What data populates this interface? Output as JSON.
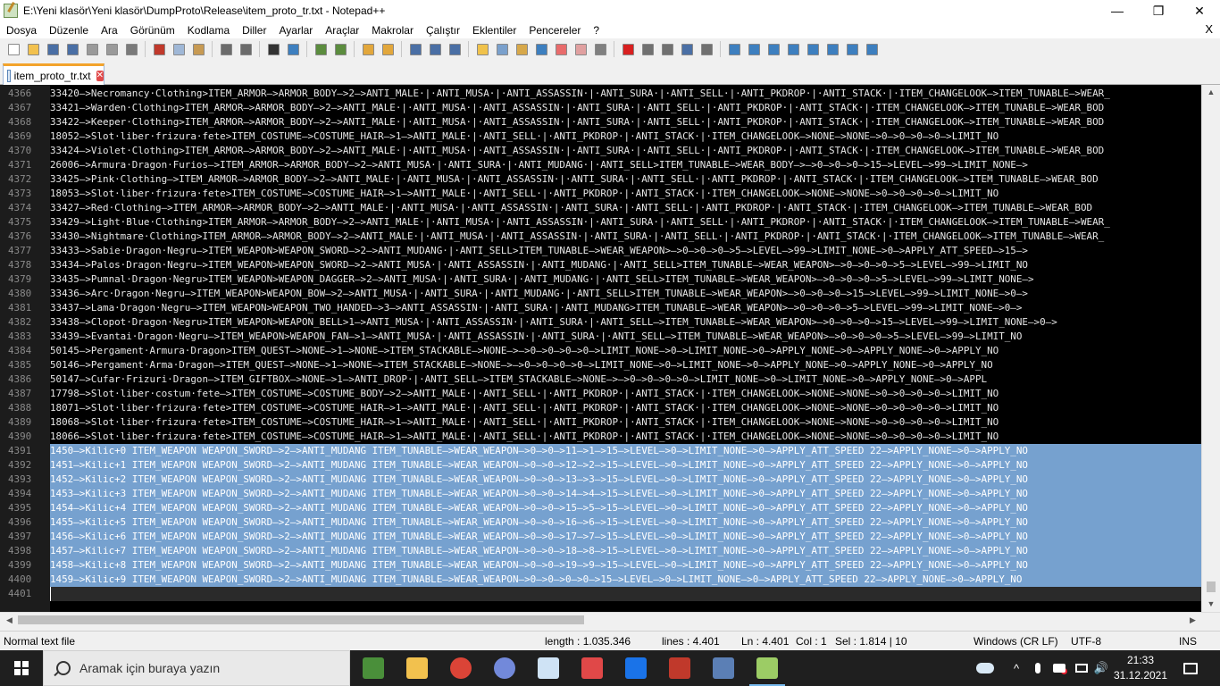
{
  "window": {
    "title": "E:\\Yeni klasör\\Yeni klasör\\DumpProto\\Release\\item_proto_tr.txt - Notepad++",
    "minimize_glyph": "—",
    "maximize_glyph": "❐",
    "close_glyph": "✕"
  },
  "menu": {
    "items": [
      "Dosya",
      "Düzenle",
      "Ara",
      "Görünüm",
      "Kodlama",
      "Diller",
      "Ayarlar",
      "Araçlar",
      "Makrolar",
      "Çalıştır",
      "Eklentiler",
      "Pencereler",
      "?"
    ],
    "close_glyph": "X"
  },
  "toolbar": {
    "buttons": [
      {
        "name": "new-file-icon",
        "color": "#ffffff"
      },
      {
        "name": "open-file-icon",
        "color": "#f2c14e"
      },
      {
        "name": "save-icon",
        "color": "#4a6fa5"
      },
      {
        "name": "save-all-icon",
        "color": "#4a6fa5"
      },
      {
        "name": "close-icon",
        "color": "#9a9a9a"
      },
      {
        "name": "close-all-icon",
        "color": "#9a9a9a"
      },
      {
        "name": "print-icon",
        "color": "#7a7a7a"
      },
      {
        "name": "cut-icon",
        "color": "#c0392b"
      },
      {
        "name": "copy-icon",
        "color": "#9fb7d6"
      },
      {
        "name": "paste-icon",
        "color": "#c79a53"
      },
      {
        "name": "undo-icon",
        "color": "#6b6b6b"
      },
      {
        "name": "redo-icon",
        "color": "#6b6b6b"
      },
      {
        "name": "find-icon",
        "color": "#333333"
      },
      {
        "name": "replace-icon",
        "color": "#3d7fbf"
      },
      {
        "name": "zoom-in-icon",
        "color": "#5b8c3e"
      },
      {
        "name": "zoom-out-icon",
        "color": "#5b8c3e"
      },
      {
        "name": "sync-vertical-icon",
        "color": "#e2a73c"
      },
      {
        "name": "sync-horizontal-icon",
        "color": "#e2a73c"
      },
      {
        "name": "word-wrap-icon",
        "color": "#4a6fa5"
      },
      {
        "name": "show-all-chars-icon",
        "color": "#4a6fa5"
      },
      {
        "name": "indent-guide-icon",
        "color": "#4a6fa5"
      },
      {
        "name": "udl-icon",
        "color": "#f0c24b"
      },
      {
        "name": "doc-map-icon",
        "color": "#7aa0cc"
      },
      {
        "name": "doc-list-icon",
        "color": "#d7a84a"
      },
      {
        "name": "function-list-icon",
        "color": "#3d7fbf"
      },
      {
        "name": "folder-workspace-icon",
        "color": "#e86b6b"
      },
      {
        "name": "monitoring-icon",
        "color": "#e0a0a0"
      },
      {
        "name": "eye-icon",
        "color": "#808080"
      },
      {
        "name": "record-macro-icon",
        "color": "#d82020"
      },
      {
        "name": "stop-macro-icon",
        "color": "#707070"
      },
      {
        "name": "play-macro-icon",
        "color": "#707070"
      },
      {
        "name": "play-macro-multiple-icon",
        "color": "#4a6fa5"
      },
      {
        "name": "save-macro-icon",
        "color": "#707070"
      },
      {
        "name": "tool-1-icon",
        "color": "#3d7fbf"
      },
      {
        "name": "tool-2-icon",
        "color": "#3d7fbf"
      },
      {
        "name": "tool-3-icon",
        "color": "#3d7fbf"
      },
      {
        "name": "tool-4-icon",
        "color": "#3d7fbf"
      },
      {
        "name": "tool-5-icon",
        "color": "#3d7fbf"
      },
      {
        "name": "tool-6-icon",
        "color": "#3d7fbf"
      },
      {
        "name": "tool-7-icon",
        "color": "#3d7fbf"
      },
      {
        "name": "tool-8-icon",
        "color": "#3d7fbf"
      }
    ]
  },
  "tabs": [
    {
      "label": "item_proto_tr.txt",
      "active": true,
      "close_glyph": "✕"
    }
  ],
  "editor": {
    "current_line": "4401",
    "lines": [
      {
        "num": "4366",
        "text": "33420—>Necromancy·Clothing>ITEM_ARMOR—>ARMOR_BODY—>2—>ANTI_MALE·|·ANTI_MUSA·|·ANTI_ASSASSIN·|·ANTI_SURA·|·ANTI_SELL·|·ANTI_PKDROP·|·ANTI_STACK·|·ITEM_CHANGELOOK—>ITEM_TUNABLE—>WEAR_",
        "sel": false
      },
      {
        "num": "4367",
        "text": "33421—>Warden·Clothing>ITEM_ARMOR—>ARMOR_BODY—>2—>ANTI_MALE·|·ANTI_MUSA·|·ANTI_ASSASSIN·|·ANTI_SURA·|·ANTI_SELL·|·ANTI_PKDROP·|·ANTI_STACK·|·ITEM_CHANGELOOK—>ITEM_TUNABLE—>WEAR_BOD",
        "sel": false
      },
      {
        "num": "4368",
        "text": "33422—>Keeper·Clothing>ITEM_ARMOR—>ARMOR_BODY—>2—>ANTI_MALE·|·ANTI_MUSA·|·ANTI_ASSASSIN·|·ANTI_SURA·|·ANTI_SELL·|·ANTI_PKDROP·|·ANTI_STACK·|·ITEM_CHANGELOOK—>ITEM_TUNABLE—>WEAR_BOD",
        "sel": false
      },
      {
        "num": "4369",
        "text": "18052—>Slot·liber·frizura·fete>ITEM_COSTUME—>COSTUME_HAIR—>1—>ANTI_MALE·|·ANTI_SELL·|·ANTI_PKDROP·|·ANTI_STACK·|·ITEM_CHANGELOOK—>NONE—>NONE—>0—>0—>0—>0—>LIMIT_NO",
        "sel": false
      },
      {
        "num": "4370",
        "text": "33424—>Violet·Clothing>ITEM_ARMOR—>ARMOR_BODY—>2—>ANTI_MALE·|·ANTI_MUSA·|·ANTI_ASSASSIN·|·ANTI_SURA·|·ANTI_SELL·|·ANTI_PKDROP·|·ANTI_STACK·|·ITEM_CHANGELOOK—>ITEM_TUNABLE—>WEAR_BOD",
        "sel": false
      },
      {
        "num": "4371",
        "text": "26006—>Armura·Dragon·Furios—>ITEM_ARMOR—>ARMOR_BODY—>2—>ANTI_MUSA·|·ANTI_SURA·|·ANTI_MUDANG·|·ANTI_SELL>ITEM_TUNABLE—>WEAR_BODY—>—>0—>0—>0—>15—>LEVEL—>99—>LIMIT_NONE—>",
        "sel": false
      },
      {
        "num": "4372",
        "text": "33425—>Pink·Clothing—>ITEM_ARMOR—>ARMOR_BODY—>2—>ANTI_MALE·|·ANTI_MUSA·|·ANTI_ASSASSIN·|·ANTI_SURA·|·ANTI_SELL·|·ANTI_PKDROP·|·ANTI_STACK·|·ITEM_CHANGELOOK—>ITEM_TUNABLE—>WEAR_BOD",
        "sel": false
      },
      {
        "num": "4373",
        "text": "18053—>Slot·liber·frizura·fete>ITEM_COSTUME—>COSTUME_HAIR—>1—>ANTI_MALE·|·ANTI_SELL·|·ANTI_PKDROP·|·ANTI_STACK·|·ITEM_CHANGELOOK—>NONE—>NONE—>0—>0—>0—>0—>LIMIT_NO",
        "sel": false
      },
      {
        "num": "4374",
        "text": "33427—>Red·Clothing—>ITEM_ARMOR—>ARMOR_BODY—>2—>ANTI_MALE·|·ANTI_MUSA·|·ANTI_ASSASSIN·|·ANTI_SURA·|·ANTI_SELL·|·ANTI_PKDROP·|·ANTI_STACK·|·ITEM_CHANGELOOK—>ITEM_TUNABLE—>WEAR_BOD",
        "sel": false
      },
      {
        "num": "4375",
        "text": "33429—>Light·Blue·Clothing>ITEM_ARMOR—>ARMOR_BODY—>2—>ANTI_MALE·|·ANTI_MUSA·|·ANTI_ASSASSIN·|·ANTI_SURA·|·ANTI_SELL·|·ANTI_PKDROP·|·ANTI_STACK·|·ITEM_CHANGELOOK—>ITEM_TUNABLE—>WEAR_",
        "sel": false
      },
      {
        "num": "4376",
        "text": "33430—>Nightmare·Clothing>ITEM_ARMOR—>ARMOR_BODY—>2—>ANTI_MALE·|·ANTI_MUSA·|·ANTI_ASSASSIN·|·ANTI_SURA·|·ANTI_SELL·|·ANTI_PKDROP·|·ANTI_STACK·|·ITEM_CHANGELOOK—>ITEM_TUNABLE—>WEAR_",
        "sel": false
      },
      {
        "num": "4377",
        "text": "33433—>Sabie·Dragon·Negru—>ITEM_WEAPON>WEAPON_SWORD—>2—>ANTI_MUDANG·|·ANTI_SELL>ITEM_TUNABLE—>WEAR_WEAPON>—>0—>0—>0—>5—>LEVEL—>99—>LIMIT_NONE—>0—>APPLY_ATT_SPEED—>15—>",
        "sel": false
      },
      {
        "num": "4378",
        "text": "33434—>Palos·Dragon·Negru—>ITEM_WEAPON>WEAPON_SWORD—>2—>ANTI_MUSA·|·ANTI_ASSASSIN·|·ANTI_MUDANG·|·ANTI_SELL>ITEM_TUNABLE—>WEAR_WEAPON>—>0—>0—>0—>5—>LEVEL—>99—>LIMIT_NO",
        "sel": false
      },
      {
        "num": "4379",
        "text": "33435—>Pumnal·Dragon·Negru>ITEM_WEAPON>WEAPON_DAGGER—>2—>ANTI_MUSA·|·ANTI_SURA·|·ANTI_MUDANG·|·ANTI_SELL>ITEM_TUNABLE—>WEAR_WEAPON>—>0—>0—>0—>5—>LEVEL—>99—>LIMIT_NONE—>",
        "sel": false
      },
      {
        "num": "4380",
        "text": "33436—>Arc·Dragon·Negru—>ITEM_WEAPON>WEAPON_BOW—>2—>ANTI_MUSA·|·ANTI_SURA·|·ANTI_MUDANG·|·ANTI_SELL>ITEM_TUNABLE—>WEAR_WEAPON>—>0—>0—>0—>15—>LEVEL—>99—>LIMIT_NONE—>0—>",
        "sel": false
      },
      {
        "num": "4381",
        "text": "33437—>Lama·Dragon·Negru—>ITEM_WEAPON>WEAPON_TWO_HANDED—>3—>ANTI_ASSASSIN·|·ANTI_SURA·|·ANTI_MUDANG>ITEM_TUNABLE—>WEAR_WEAPON>—>0—>0—>0—>5—>LEVEL—>99—>LIMIT_NONE—>0—>",
        "sel": false
      },
      {
        "num": "4382",
        "text": "33438—>Clopot·Dragon·Negru>ITEM_WEAPON>WEAPON_BELL>1—>ANTI_MUSA·|·ANTI_ASSASSIN·|·ANTI_SURA·|·ANTI_SELL—>ITEM_TUNABLE—>WEAR_WEAPON>—>0—>0—>0—>15—>LEVEL—>99—>LIMIT_NONE—>0—>",
        "sel": false
      },
      {
        "num": "4383",
        "text": "33439—>Evantai·Dragon·Negru—>ITEM_WEAPON>WEAPON_FAN—>1—>ANTI_MUSA·|·ANTI_ASSASSIN·|·ANTI_SURA·|·ANTI_SELL—>ITEM_TUNABLE—>WEAR_WEAPON>—>0—>0—>0—>5—>LEVEL—>99—>LIMIT_NO",
        "sel": false
      },
      {
        "num": "4384",
        "text": "50145—>Pergament·Armura·Dragon>ITEM_QUEST—>NONE—>1—>NONE—>ITEM_STACKABLE—>NONE—>—>0—>0—>0—>0—>LIMIT_NONE—>0—>LIMIT_NONE—>0—>APPLY_NONE—>0—>APPLY_NONE—>0—>APPLY_NO",
        "sel": false
      },
      {
        "num": "4385",
        "text": "50146—>Pergament·Arma·Dragon—>ITEM_QUEST—>NONE—>1—>NONE—>ITEM_STACKABLE—>NONE—>—>0—>0—>0—>0—>LIMIT_NONE—>0—>LIMIT_NONE—>0—>APPLY_NONE—>0—>APPLY_NONE—>0—>APPLY_NO",
        "sel": false
      },
      {
        "num": "4386",
        "text": "50147—>Cufar·Frizuri·Dragon—>ITEM_GIFTBOX—>NONE—>1—>ANTI_DROP·|·ANTI_SELL—>ITEM_STACKABLE—>NONE—>—>0—>0—>0—>0—>LIMIT_NONE—>0—>LIMIT_NONE—>0—>APPLY_NONE—>0—>APPL",
        "sel": false
      },
      {
        "num": "4387",
        "text": "17798—>Slot·liber·costum·fete—>ITEM_COSTUME—>COSTUME_BODY—>2—>ANTI_MALE·|·ANTI_SELL·|·ANTI_PKDROP·|·ANTI_STACK·|·ITEM_CHANGELOOK—>NONE—>NONE—>0—>0—>0—>0—>LIMIT_NO",
        "sel": false
      },
      {
        "num": "4388",
        "text": "18071—>Slot·liber·frizura·fete>ITEM_COSTUME—>COSTUME_HAIR—>1—>ANTI_MALE·|·ANTI_SELL·|·ANTI_PKDROP·|·ANTI_STACK·|·ITEM_CHANGELOOK—>NONE—>NONE—>0—>0—>0—>0—>LIMIT_NO",
        "sel": false
      },
      {
        "num": "4389",
        "text": "18068—>Slot·liber·frizura·fete>ITEM_COSTUME—>COSTUME_HAIR—>1—>ANTI_MALE·|·ANTI_SELL·|·ANTI_PKDROP·|·ANTI_STACK·|·ITEM_CHANGELOOK—>NONE—>NONE—>0—>0—>0—>0—>LIMIT_NO",
        "sel": false
      },
      {
        "num": "4390",
        "text": "18066—>Slot·liber·frizura·fete>ITEM_COSTUME—>COSTUME_HAIR—>1—>ANTI_MALE·|·ANTI_SELL·|·ANTI_PKDROP·|·ANTI_STACK·|·ITEM_CHANGELOOK—>NONE—>NONE—>0—>0—>0—>0—>LIMIT_NO",
        "sel": false
      },
      {
        "num": "4391",
        "text": "1450—>Kilic+0 ITEM_WEAPON WEAPON_SWORD—>2—>ANTI_MUDANG ITEM_TUNABLE—>WEAR_WEAPON—>0—>0—>11—>1—>15—>LEVEL—>0—>LIMIT_NONE—>0—>APPLY_ATT_SPEED 22—>APPLY_NONE—>0—>APPLY_NO",
        "sel": true
      },
      {
        "num": "4392",
        "text": "1451—>Kilic+1 ITEM_WEAPON WEAPON_SWORD—>2—>ANTI_MUDANG ITEM_TUNABLE—>WEAR_WEAPON—>0—>0—>12—>2—>15—>LEVEL—>0—>LIMIT_NONE—>0—>APPLY_ATT_SPEED 22—>APPLY_NONE—>0—>APPLY_NO",
        "sel": true
      },
      {
        "num": "4393",
        "text": "1452—>Kilic+2 ITEM_WEAPON WEAPON_SWORD—>2—>ANTI_MUDANG ITEM_TUNABLE—>WEAR_WEAPON—>0—>0—>13—>3—>15—>LEVEL—>0—>LIMIT_NONE—>0—>APPLY_ATT_SPEED 22—>APPLY_NONE—>0—>APPLY_NO",
        "sel": true
      },
      {
        "num": "4394",
        "text": "1453—>Kilic+3 ITEM_WEAPON WEAPON_SWORD—>2—>ANTI_MUDANG ITEM_TUNABLE—>WEAR_WEAPON—>0—>0—>14—>4—>15—>LEVEL—>0—>LIMIT_NONE—>0—>APPLY_ATT_SPEED 22—>APPLY_NONE—>0—>APPLY_NO",
        "sel": true
      },
      {
        "num": "4395",
        "text": "1454—>Kilic+4 ITEM_WEAPON WEAPON_SWORD—>2—>ANTI_MUDANG ITEM_TUNABLE—>WEAR_WEAPON—>0—>0—>15—>5—>15—>LEVEL—>0—>LIMIT_NONE—>0—>APPLY_ATT_SPEED 22—>APPLY_NONE—>0—>APPLY_NO",
        "sel": true
      },
      {
        "num": "4396",
        "text": "1455—>Kilic+5 ITEM_WEAPON WEAPON_SWORD—>2—>ANTI_MUDANG ITEM_TUNABLE—>WEAR_WEAPON—>0—>0—>16—>6—>15—>LEVEL—>0—>LIMIT_NONE—>0—>APPLY_ATT_SPEED 22—>APPLY_NONE—>0—>APPLY_NO",
        "sel": true
      },
      {
        "num": "4397",
        "text": "1456—>Kilic+6 ITEM_WEAPON WEAPON_SWORD—>2—>ANTI_MUDANG ITEM_TUNABLE—>WEAR_WEAPON—>0—>0—>17—>7—>15—>LEVEL—>0—>LIMIT_NONE—>0—>APPLY_ATT_SPEED 22—>APPLY_NONE—>0—>APPLY_NO",
        "sel": true
      },
      {
        "num": "4398",
        "text": "1457—>Kilic+7 ITEM_WEAPON WEAPON_SWORD—>2—>ANTI_MUDANG ITEM_TUNABLE—>WEAR_WEAPON—>0—>0—>18—>8—>15—>LEVEL—>0—>LIMIT_NONE—>0—>APPLY_ATT_SPEED 22—>APPLY_NONE—>0—>APPLY_NO",
        "sel": true
      },
      {
        "num": "4399",
        "text": "1458—>Kilic+8 ITEM_WEAPON WEAPON_SWORD—>2—>ANTI_MUDANG ITEM_TUNABLE—>WEAR_WEAPON—>0—>0—>19—>9—>15—>LEVEL—>0—>LIMIT_NONE—>0—>APPLY_ATT_SPEED 22—>APPLY_NONE—>0—>APPLY_NO",
        "sel": true
      },
      {
        "num": "4400",
        "text": "1459—>Kilic+9 ITEM_WEAPON WEAPON_SWORD—>2—>ANTI_MUDANG ITEM_TUNABLE—>WEAR_WEAPON—>0—>0—>0—>0—>15—>LEVEL—>0—>LIMIT_NONE—>0—>APPLY_ATT_SPEED 22—>APPLY_NONE—>0—>APPLY_NO",
        "sel": true
      },
      {
        "num": "4401",
        "text": "",
        "sel": false
      }
    ]
  },
  "status": {
    "file_type": "Normal text file",
    "length": "length : 1.035.346",
    "lines": "lines : 4.401",
    "ln": "Ln : 4.401",
    "col": "Col : 1",
    "sel": "Sel : 1.814 | 10",
    "eol": "Windows (CR LF)",
    "encoding": "UTF-8",
    "mode": "INS"
  },
  "taskbar": {
    "search_placeholder": "Aramak için buraya yazın",
    "apps": [
      {
        "name": "task-manager-icon",
        "color": "#4a8f3a"
      },
      {
        "name": "file-explorer-icon",
        "color": "#f2c14e"
      },
      {
        "name": "chrome-icon",
        "color": "#db4437"
      },
      {
        "name": "discord-icon",
        "color": "#7289da"
      },
      {
        "name": "3d-viewer-icon",
        "color": "#cfe3f5"
      },
      {
        "name": "app-red-icon",
        "color": "#e04848"
      },
      {
        "name": "teamviewer-icon",
        "color": "#1a73e8"
      },
      {
        "name": "filezilla-icon",
        "color": "#c0392b"
      },
      {
        "name": "network-app-icon",
        "color": "#5b7fb5"
      },
      {
        "name": "notepadpp-taskbar-icon",
        "color": "#9ccc65"
      }
    ],
    "time": "21:33",
    "date": "31.12.2021",
    "tray_up_glyph": "^",
    "speaker_glyph": "🔊"
  }
}
